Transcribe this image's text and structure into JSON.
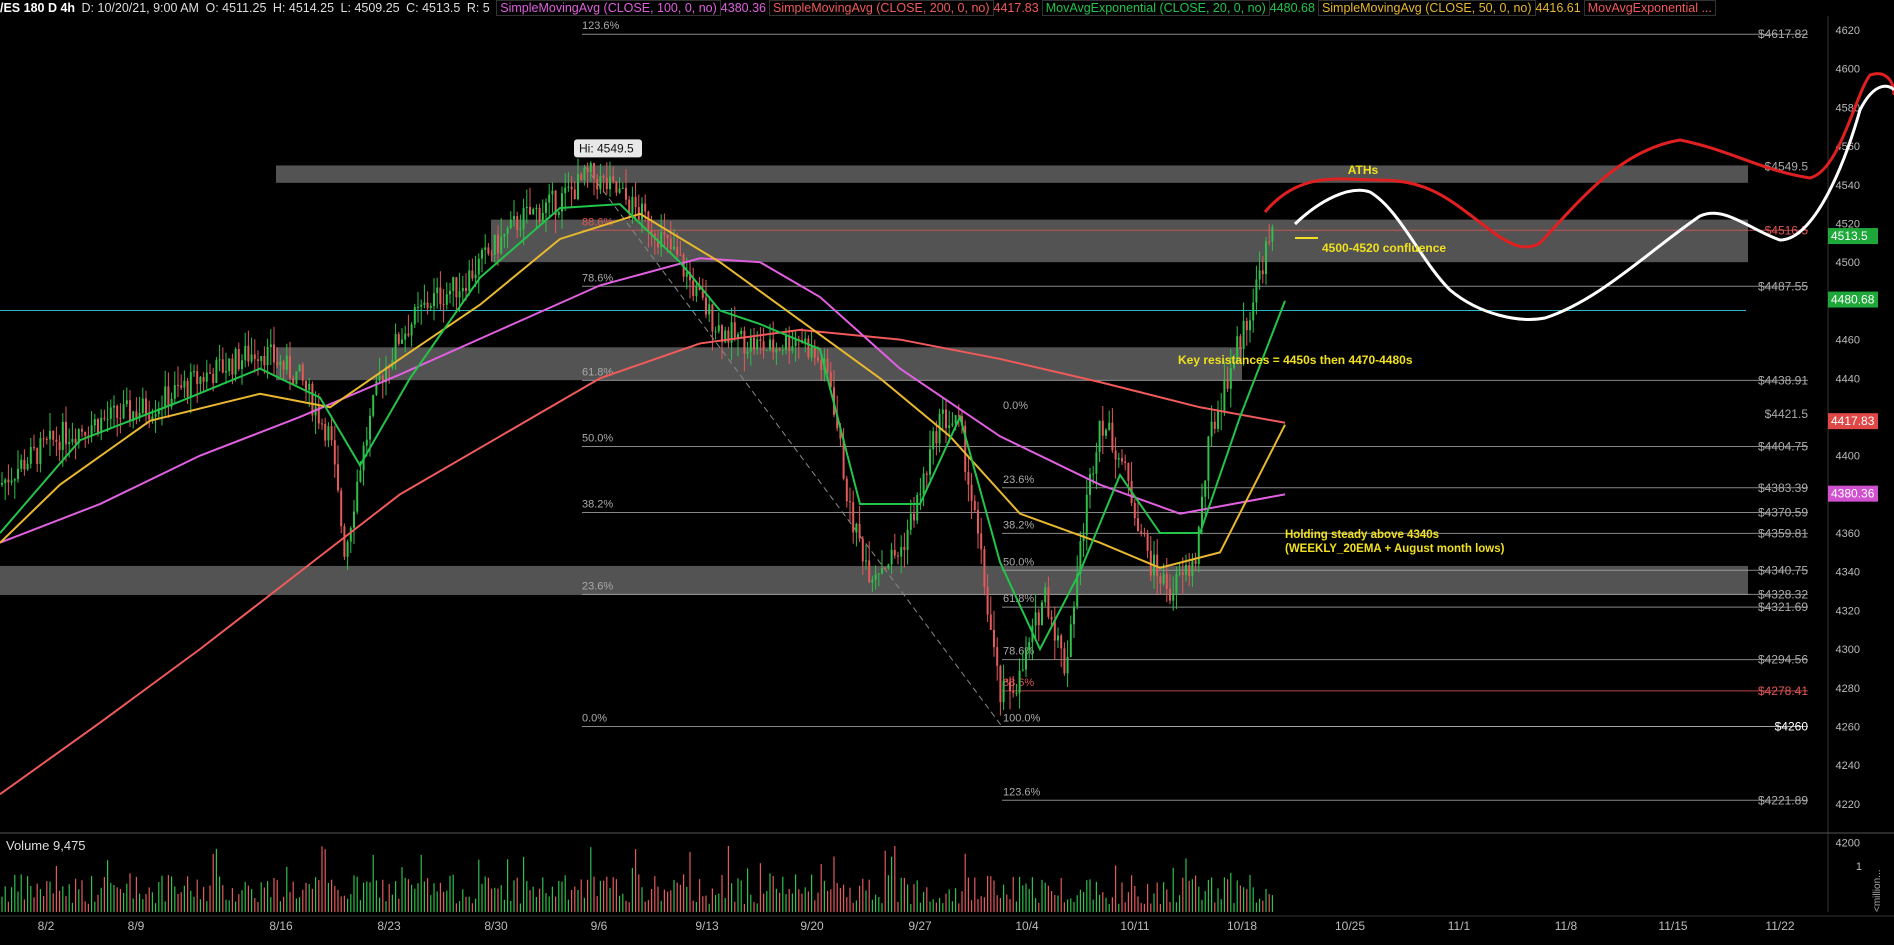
{
  "header": {
    "symbol": "/ES 180 D 4h",
    "date": "D: 10/20/21, 9:00 AM",
    "open": "O: 4511.25",
    "high": "H: 4514.25",
    "low": "L: 4509.25",
    "close": "C: 4513.5",
    "range": "R: 5",
    "studies": [
      {
        "label": "SimpleMovingAvg (CLOSE, 100, 0, no)",
        "value": "4380.36",
        "color": "#e060e0"
      },
      {
        "label": "SimpleMovingAvg (CLOSE, 200, 0, no)",
        "value": "4417.83",
        "color": "#f05a5a"
      },
      {
        "label": "MovAvgExponential (CLOSE, 20, 0, no)",
        "value": "4480.68",
        "color": "#22c44a"
      },
      {
        "label": "SimpleMovingAvg (CLOSE, 50, 0, no)",
        "value": "4416.61",
        "color": "#e8b830"
      },
      {
        "label": "MovAvgExponential ...",
        "value": "",
        "color": "#f05a5a"
      }
    ]
  },
  "chart_data": {
    "type": "line",
    "title": "/ES 180 D 4h",
    "price_axis": {
      "ticks": [
        4200,
        4220,
        4240,
        4260,
        4280,
        4300,
        4320,
        4340,
        4360,
        4380,
        4400,
        4420,
        4440,
        4460,
        4480,
        4500,
        4520,
        4540,
        4560,
        4580,
        4600,
        4620
      ],
      "range": [
        4200,
        4625
      ]
    },
    "date_axis": {
      "ticks": [
        "8/2",
        "8/9",
        "8/16",
        "8/23",
        "8/30",
        "9/6",
        "9/13",
        "9/20",
        "9/27",
        "10/4",
        "10/11",
        "10/18",
        "10/25",
        "11/1",
        "11/8",
        "11/15",
        "11/22"
      ]
    },
    "price_levels": [
      {
        "label": "$4617.82",
        "price": 4617.82,
        "color": "#aaaaaa"
      },
      {
        "label": "$4549.5",
        "price": 4549.5,
        "color": "#aaaaaa"
      },
      {
        "label": "$4516.5",
        "price": 4516.5,
        "color": "#e05555"
      },
      {
        "label": "$4487.55",
        "price": 4487.55,
        "color": "#aaaaaa"
      },
      {
        "label": "$4438.91",
        "price": 4438.91,
        "color": "#aaaaaa"
      },
      {
        "label": "$4421.5",
        "price": 4421.5,
        "color": "#aaaaaa"
      },
      {
        "label": "$4404.75",
        "price": 4404.75,
        "color": "#aaaaaa"
      },
      {
        "label": "$4383.39",
        "price": 4383.39,
        "color": "#aaaaaa"
      },
      {
        "label": "$4370.59",
        "price": 4370.59,
        "color": "#aaaaaa"
      },
      {
        "label": "$4359.81",
        "price": 4359.81,
        "color": "#aaaaaa"
      },
      {
        "label": "$4340.75",
        "price": 4340.75,
        "color": "#aaaaaa"
      },
      {
        "label": "$4328.32",
        "price": 4328.32,
        "color": "#aaaaaa"
      },
      {
        "label": "$4321.69",
        "price": 4321.69,
        "color": "#aaaaaa"
      },
      {
        "label": "$4294.56",
        "price": 4294.56,
        "color": "#aaaaaa"
      },
      {
        "label": "$4278.41",
        "price": 4278.41,
        "color": "#e05555"
      },
      {
        "label": "$4260",
        "price": 4260,
        "color": "#ffffff"
      },
      {
        "label": "$4221.89",
        "price": 4221.89,
        "color": "#aaaaaa"
      }
    ],
    "last_price_tags": [
      {
        "label": "4513.5",
        "price": 4513.5,
        "color": "#1fa83a"
      },
      {
        "label": "4480.68",
        "price": 4480.68,
        "color": "#1fa83a"
      },
      {
        "label": "4417.83",
        "price": 4417.83,
        "color": "#e04848"
      },
      {
        "label": "4380.36",
        "price": 4380.36,
        "color": "#d050d0"
      }
    ],
    "fib_big": [
      {
        "label": "123.6%",
        "price": 4617.82,
        "color": "#aaaaaa"
      },
      {
        "label": "88.6%",
        "price": 4516.5,
        "color": "#e05555"
      },
      {
        "label": "78.6%",
        "price": 4487.55,
        "color": "#aaaaaa"
      },
      {
        "label": "61.8%",
        "price": 4438.91,
        "color": "#aaaaaa"
      },
      {
        "label": "50.0%",
        "price": 4404.75,
        "color": "#aaaaaa"
      },
      {
        "label": "38.2%",
        "price": 4370.59,
        "color": "#aaaaaa"
      },
      {
        "label": "23.6%",
        "price": 4328.32,
        "color": "#aaaaaa"
      },
      {
        "label": "0.0%",
        "price": 4260,
        "color": "#aaaaaa"
      }
    ],
    "fib_small": [
      {
        "label": "0.0%",
        "price": 4421.5,
        "color": "#aaaaaa"
      },
      {
        "label": "23.6%",
        "price": 4383.39,
        "color": "#aaaaaa"
      },
      {
        "label": "38.2%",
        "price": 4359.81,
        "color": "#aaaaaa"
      },
      {
        "label": "50.0%",
        "price": 4340.75,
        "color": "#aaaaaa"
      },
      {
        "label": "61.8%",
        "price": 4321.69,
        "color": "#aaaaaa"
      },
      {
        "label": "78.6%",
        "price": 4294.56,
        "color": "#aaaaaa"
      },
      {
        "label": "88.6%",
        "price": 4278.41,
        "color": "#e05555"
      },
      {
        "label": "100.0%",
        "price": 4260,
        "color": "#aaaaaa"
      },
      {
        "label": "123.6%",
        "price": 4221.89,
        "color": "#aaaaaa"
      }
    ],
    "zones": [
      {
        "from": 4541,
        "to": 4550,
        "date_from": "8/16",
        "date_to": "11/22"
      },
      {
        "from": 4500,
        "to": 4522,
        "date_from": "8/30",
        "date_to": "11/22"
      },
      {
        "from": 4439,
        "to": 4456,
        "date_from": "8/16",
        "date_to": "10/18"
      },
      {
        "from": 4328,
        "to": 4343,
        "date_from": "8/2",
        "date_to": "11/22"
      }
    ],
    "cyan_line": 4475,
    "high_marker": {
      "label": "Hi: 4549.5",
      "price": 4549.5,
      "date": "9/6"
    },
    "annotations": [
      {
        "text": "ATHs",
        "color": "#f0e020"
      },
      {
        "text": "4500-4520 confluence",
        "color": "#f0e020"
      },
      {
        "text": "Key resistances = 4450s then 4470-4480s",
        "color": "#f0e020"
      },
      {
        "text": "Holding steady above 4340s",
        "color": "#f0e020"
      },
      {
        "text": "(WEEKLY_20EMA + August month lows)",
        "color": "#f0e020"
      }
    ],
    "volume": {
      "label": "Volume",
      "value": "9,475",
      "ticks": [
        "1"
      ]
    },
    "volume_axis_text": "<million..."
  }
}
